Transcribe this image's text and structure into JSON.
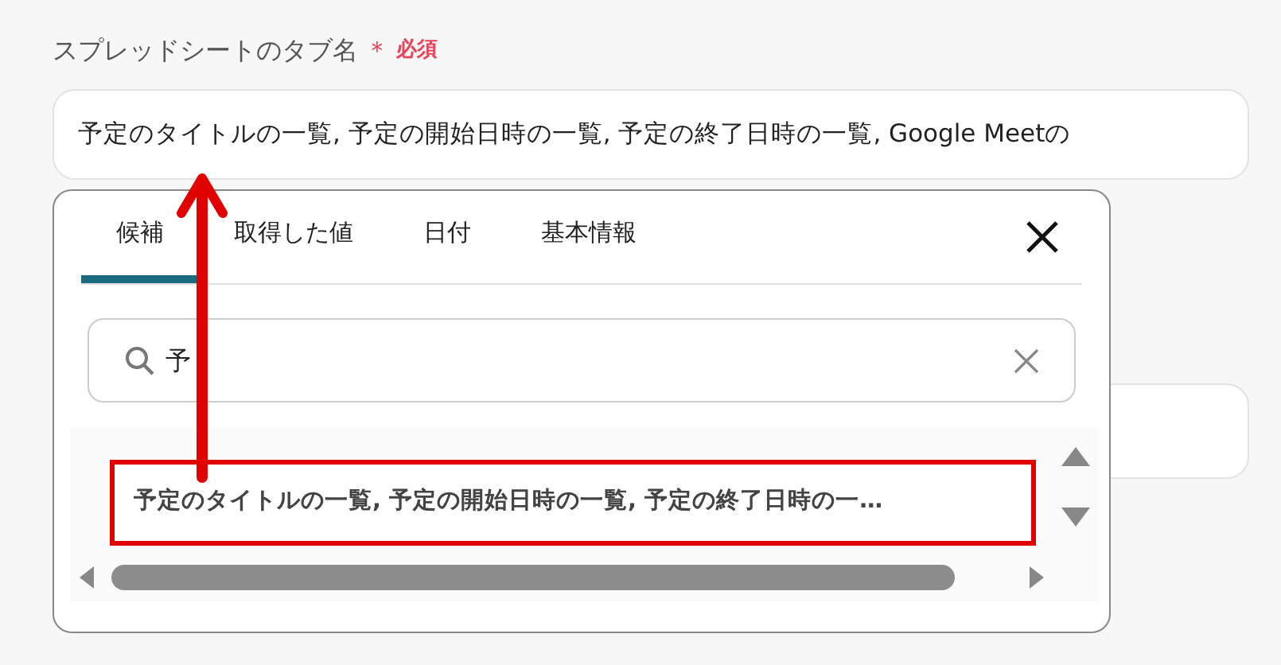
{
  "field": {
    "label": "スプレッドシートのタブ名",
    "required_mark": "＊",
    "required_text": "必須",
    "value": "予定のタイトルの一覧, 予定の開始日時の一覧, 予定の終了日時の一覧, Google Meetの"
  },
  "popup": {
    "tabs": [
      {
        "label": "候補",
        "selected": true
      },
      {
        "label": "取得した値",
        "selected": false
      },
      {
        "label": "日付",
        "selected": false
      },
      {
        "label": "基本情報",
        "selected": false
      }
    ],
    "search": {
      "value": "予"
    },
    "results": [
      {
        "text": "予定のタイトルの一覧, 予定の開始日時の一覧, 予定の終了日時の一…",
        "highlighted": true
      }
    ]
  }
}
